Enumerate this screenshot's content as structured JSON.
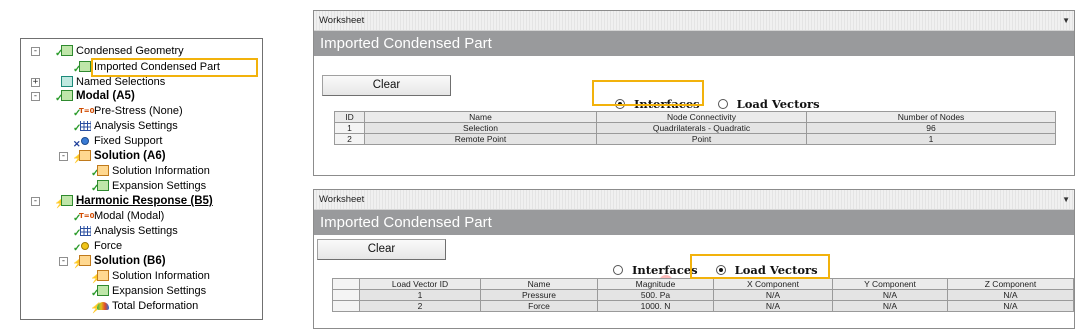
{
  "tree": {
    "items": [
      {
        "label": "Condensed Geometry",
        "expander": "-",
        "icon": "condensed-geometry-icon"
      },
      {
        "label": "Imported Condensed Part",
        "icon": "imported-part-icon"
      },
      {
        "label": "Named Selections",
        "expander": "+",
        "icon": "named-selections-icon"
      },
      {
        "label": "Modal (A5)",
        "expander": "-",
        "icon": "modal-analysis-icon"
      },
      {
        "label": "Pre-Stress (None)",
        "icon": "pre-stress-icon"
      },
      {
        "label": "Analysis Settings",
        "icon": "analysis-settings-icon"
      },
      {
        "label": "Fixed Support",
        "icon": "fixed-support-icon"
      },
      {
        "label": "Solution (A6)",
        "expander": "-",
        "icon": "solution-icon"
      },
      {
        "label": "Solution Information",
        "icon": "solution-information-icon"
      },
      {
        "label": "Expansion Settings",
        "icon": "expansion-settings-icon"
      },
      {
        "label": "Harmonic Response (B5)",
        "expander": "-",
        "icon": "harmonic-response-icon"
      },
      {
        "label": "Modal (Modal)",
        "icon": "modal-link-icon"
      },
      {
        "label": "Analysis Settings",
        "icon": "analysis-settings-icon"
      },
      {
        "label": "Force",
        "icon": "force-icon"
      },
      {
        "label": "Solution (B6)",
        "expander": "-",
        "icon": "solution-icon"
      },
      {
        "label": "Solution Information",
        "icon": "solution-information-icon"
      },
      {
        "label": "Expansion Settings",
        "icon": "expansion-settings-icon"
      },
      {
        "label": "Total Deformation",
        "icon": "total-deformation-icon"
      }
    ]
  },
  "worksheet1": {
    "bar_label": "Worksheet",
    "title": "Imported Condensed Part",
    "clear_label": "Clear",
    "radio_interfaces": "Interfaces",
    "radio_load_vectors": "Load Vectors",
    "selected": "Interfaces",
    "columns": [
      "ID",
      "Name",
      "Node Connectivity",
      "Number of Nodes"
    ],
    "rows": [
      [
        "1",
        "Selection",
        "Quadrilaterals - Quadratic",
        "96"
      ],
      [
        "2",
        "Remote Point",
        "Point",
        "1"
      ]
    ]
  },
  "worksheet2": {
    "bar_label": "Worksheet",
    "title": "Imported Condensed Part",
    "clear_label": "Clear",
    "radio_interfaces": "Interfaces",
    "radio_load_vectors": "Load Vectors",
    "selected": "Load Vectors",
    "columns": [
      "Load Vector ID",
      "Name",
      "Magnitude",
      "X Component",
      "Y Component",
      "Z Component"
    ],
    "rows": [
      [
        "1",
        "Pressure",
        "500. Pa",
        "N/A",
        "N/A",
        "N/A"
      ],
      [
        "2",
        "Force",
        "1000. N",
        "N/A",
        "N/A",
        "N/A"
      ]
    ]
  },
  "colors": {
    "highlight": "#f2b20c",
    "title_bar": "#999a9c",
    "check_green": "#2a9b2a"
  }
}
